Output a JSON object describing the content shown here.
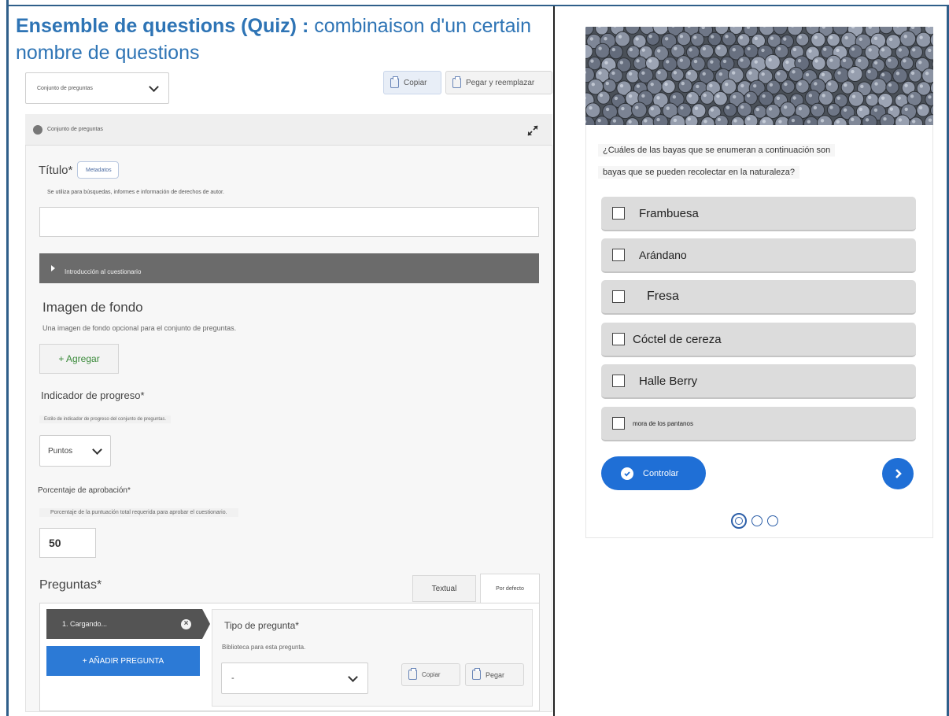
{
  "doc": {
    "title_bold": "Ensemble de questions (Quiz) :",
    "title_rest": " combinaison d'un certain nombre de questions"
  },
  "editor": {
    "content_type_select": "Conjunto de preguntas",
    "copy_label": "Copiar",
    "paste_replace_label": "Pegar y reemplazar",
    "section_header": "Conjunto de preguntas",
    "title_label": "Título*",
    "metadata_label": "Metadatos",
    "title_help": "Se utiliza para búsquedas, informes e información de derechos de autor.",
    "title_value": "",
    "intro_label": "Introducción al cuestionario",
    "bg_image_label": "Imagen de fondo",
    "bg_image_help": "Una imagen de fondo opcional para el conjunto de preguntas.",
    "add_label": "+ Agregar",
    "progress_label": "Indicador de progreso*",
    "progress_help": "Estilo de indicador de progreso del conjunto de preguntas.",
    "progress_value": "Puntos",
    "pass_label": "Porcentaje de aprobación*",
    "pass_help": "Porcentaje de la puntuación total requerida para aprobar el cuestionario.",
    "pass_value": "50",
    "questions_label": "Preguntas*",
    "tab_textual": "Textual",
    "tab_default": "Por defecto",
    "question_item": "1. Cargando...",
    "add_question_label": "+ AÑADIR PREGUNTA",
    "question_type_label": "Tipo de pregunta*",
    "question_type_help": "Biblioteca para esta pregunta.",
    "question_type_value": "-",
    "q_copy_label": "Copiar",
    "q_paste_label": "Pegar"
  },
  "quiz": {
    "question_line1": "¿Cuáles de las bayas que se enumeran a continuación son",
    "question_line2": "bayas que se pueden recolectar en la naturaleza?",
    "options": [
      "Frambuesa",
      "Arándano",
      "Fresa",
      "Cóctel de cereza",
      "Halle Berry",
      "mora de los pantanos"
    ],
    "check_label": "Controlar",
    "pages_total": 3,
    "current_page": 1
  },
  "colors": {
    "doc_title": "#2e74b5",
    "primary_blue": "#1f6fd6",
    "add_question_blue": "#2c7ad6",
    "intro_bar": "#6b6b6b"
  }
}
